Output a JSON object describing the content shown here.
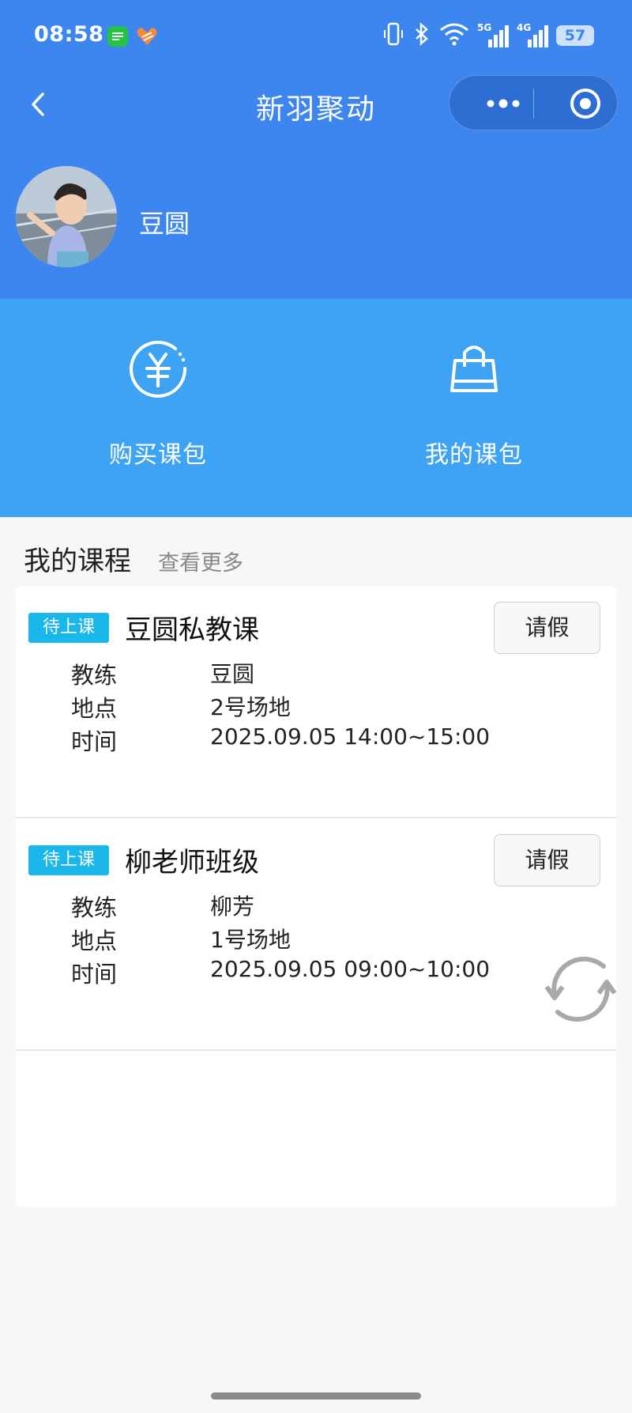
{
  "status_bar": {
    "time": "08:58",
    "battery": "57",
    "net_5g": "5G",
    "net_4g": "4G"
  },
  "header": {
    "title": "新羽聚动",
    "username": "豆圆"
  },
  "actions": [
    {
      "label": "购买课包",
      "icon": "yuan-coin-icon"
    },
    {
      "label": "我的课包",
      "icon": "shopping-bag-icon"
    }
  ],
  "section": {
    "title": "我的课程",
    "more": "查看更多"
  },
  "courses": [
    {
      "tag": "待上课",
      "name": "豆圆私教课",
      "leave_label": "请假",
      "coach_label": "教练",
      "coach": "豆圆",
      "place_label": "地点",
      "place": "2号场地",
      "time_label": "时间",
      "time": "2025.09.05 14:00~15:00"
    },
    {
      "tag": "待上课",
      "name": "柳老师班级",
      "leave_label": "请假",
      "coach_label": "教练",
      "coach": "柳芳",
      "place_label": "地点",
      "place": "1号场地",
      "time_label": "时间",
      "time": "2025.09.05 09:00~10:00"
    }
  ],
  "colors": {
    "header_bg": "#3d86f0",
    "actions_bg": "#3ea3f3",
    "tag_bg": "#1ab7ea"
  }
}
